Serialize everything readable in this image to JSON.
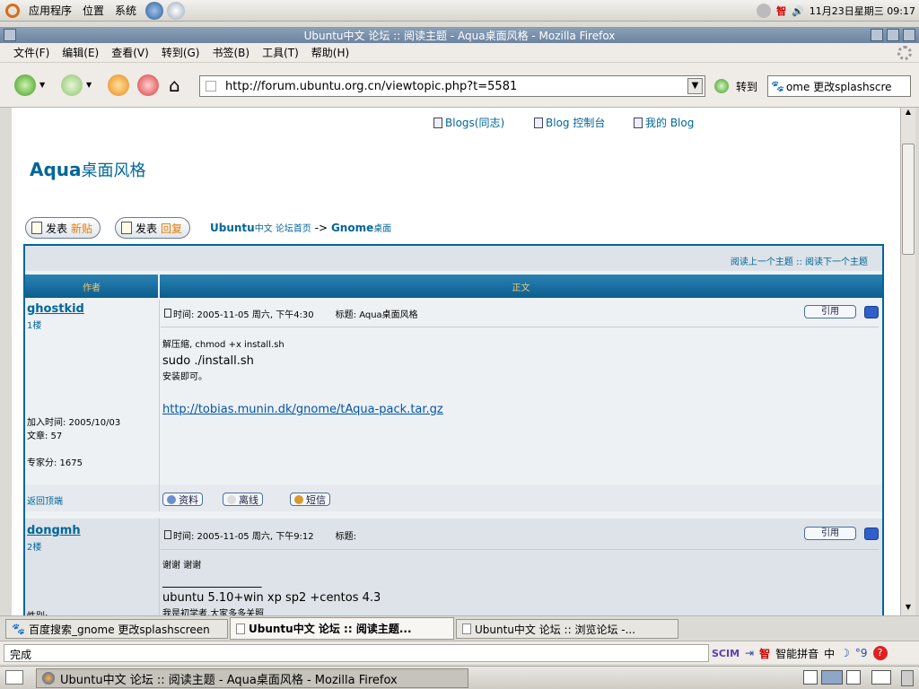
{
  "panel": {
    "menus": [
      "应用程序",
      "位置",
      "系统"
    ],
    "clock": "11月23日星期三 09:17",
    "ime_icon": "智"
  },
  "window": {
    "title": "Ubuntu中文 论坛 :: 阅读主题 - Aqua桌面风格 - Mozilla Firefox"
  },
  "menubar": [
    "文件(F)",
    "编辑(E)",
    "查看(V)",
    "转到(G)",
    "书签(B)",
    "工具(T)",
    "帮助(H)"
  ],
  "navbar": {
    "url": "http://forum.ubuntu.org.cn/viewtopic.php?t=5581",
    "go_label": "转到",
    "search_value": "ome 更改splashscre"
  },
  "page": {
    "top_links": [
      "Blogs(同志)",
      "Blog 控制台",
      "我的 Blog"
    ],
    "title_latin": "Aqua",
    "title_cn": "桌面风格",
    "new_post": {
      "a": "发表",
      "b": "新贴"
    },
    "reply": {
      "a": "发表",
      "b": "回复"
    },
    "breadcrumb": {
      "site": "Ubuntu",
      "site_cn": "中文 论坛首页",
      "sep": "->",
      "forum": "Gnome",
      "forum_cn": "桌面"
    },
    "topic_nav": "阅读上一个主题 :: 阅读下一个主题",
    "headers": {
      "author": "作者",
      "body": "正文"
    },
    "posts": [
      {
        "author": "ghostkid",
        "floor": "1楼",
        "time": "时间: 2005-11-05 周六, 下午4:30",
        "subject": "标题: Aqua桌面风格",
        "quote": "引用",
        "lines": [
          "解压缩, chmod +x install.sh",
          "sudo ./install.sh",
          "安装即可。"
        ],
        "link": "http://tobias.munin.dk/gnome/tAqua-pack.tar.gz",
        "joined": "加入时间: 2005/10/03",
        "posts_count": "文章: 57",
        "score": "专家分: 1675",
        "back_top": "返回顶端",
        "actions": [
          "资料",
          "离线",
          "短信"
        ]
      },
      {
        "author": "dongmh",
        "floor": "2楼",
        "time": "时间: 2005-11-05 周六, 下午9:12",
        "subject": "标题:",
        "quote": "引用",
        "lines": [
          "谢谢 谢谢",
          "_________________",
          "ubuntu 5.10+win xp sp2 +centos 4.3",
          "我是初学者,大家多多关照"
        ],
        "gender": "性别:"
      }
    ]
  },
  "tabs": [
    "百度搜索_gnome 更改splashscreen",
    "Ubuntu中文 论坛 :: 阅读主题...",
    "Ubuntu中文 论坛 :: 浏览论坛 -..."
  ],
  "status": {
    "text": "完成",
    "ime_name": "智能拼音",
    "ime_mode": "中",
    "ime_punct": "°9"
  },
  "taskbar": {
    "task": "Ubuntu中文 论坛 :: 阅读主题 - Aqua桌面风格 - Mozilla Firefox"
  }
}
